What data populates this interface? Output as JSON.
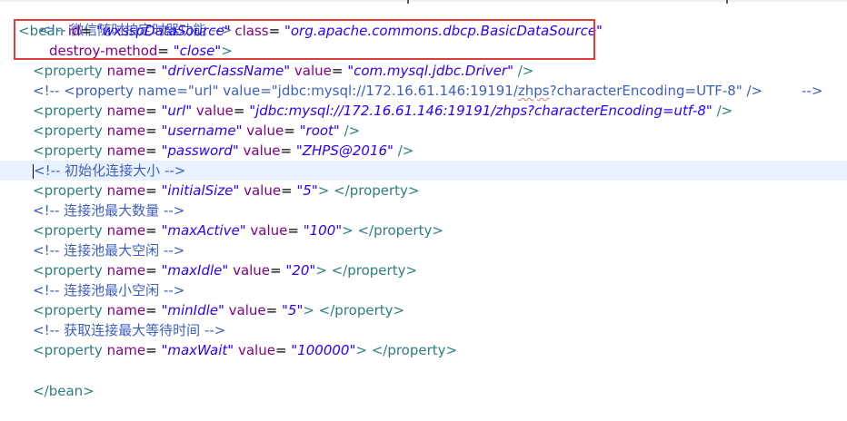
{
  "top_comment": "<!-- 微信随时拍定时器功能 -->",
  "bean_open_start": "<bean ",
  "bean_id_attr": "id",
  "bean_id_value": "\"wxsspDataSource\"",
  "bean_class_attr": "class",
  "bean_class_value": "\"org.apache.commons.dbcp.BasicDataSource\"",
  "destroy_attr": "destroy-method",
  "destroy_value": "\"close\"",
  "destroy_end": ">",
  "lines": [
    {
      "type": "prop",
      "name": "\"driverClassName\"",
      "value": "\"com.mysql.jdbc.Driver\"",
      "end": " />"
    },
    {
      "type": "commented_prop",
      "text_before": "<!-- <property name=\"url\" value=\"jdbc:mysql://172.16.61.146:19191/",
      "squiggle": "zhps",
      "text_after": "?characterEncoding=UTF-8\" />         -->"
    },
    {
      "type": "prop",
      "name": "\"url\"",
      "value": "\"jdbc:mysql://172.16.61.146:19191/zhps?characterEncoding=utf-8\"",
      "end": " />"
    },
    {
      "type": "prop",
      "name": "\"username\"",
      "value": "\"root\"",
      "end": " />"
    },
    {
      "type": "prop",
      "name": "\"password\"",
      "value": "\"ZHPS@2016\"",
      "end": " />"
    },
    {
      "type": "comment",
      "text": "<!-- 初始化连接大小 -->"
    },
    {
      "type": "prop_close",
      "name": "\"initialSize\"",
      "value": "\"5\"",
      "end": "> </property>"
    },
    {
      "type": "comment",
      "text": "<!-- 连接池最大数量 -->"
    },
    {
      "type": "prop_close",
      "name": "\"maxActive\"",
      "value": "\"100\"",
      "end": "> </property>"
    },
    {
      "type": "comment",
      "text": "<!-- 连接池最大空闲 -->"
    },
    {
      "type": "prop_close",
      "name": "\"maxIdle\"",
      "value": "\"20\"",
      "end": "> </property>"
    },
    {
      "type": "comment",
      "text": "<!-- 连接池最小空闲 -->"
    },
    {
      "type": "prop_close",
      "name": "\"minIdle\"",
      "value": "\"5\"",
      "end": "> </property>"
    },
    {
      "type": "comment",
      "text": "<!-- 获取连接最大等待时间 -->"
    },
    {
      "type": "prop_close",
      "name": "\"maxWait\"",
      "value": "\"100000\"",
      "end": "> </property>"
    }
  ],
  "bean_close": "</bean>",
  "labels": {
    "property_open": "<property ",
    "name_attr": "name",
    "value_attr": "value",
    "equals": "= "
  },
  "colors": {
    "tag": "#2f7f7f",
    "attribute": "#7f007f",
    "value": "#2a00ff",
    "comment": "#3f5fbf",
    "highlight": "#e8f2fe",
    "annotation_box": "#e23b3b"
  }
}
